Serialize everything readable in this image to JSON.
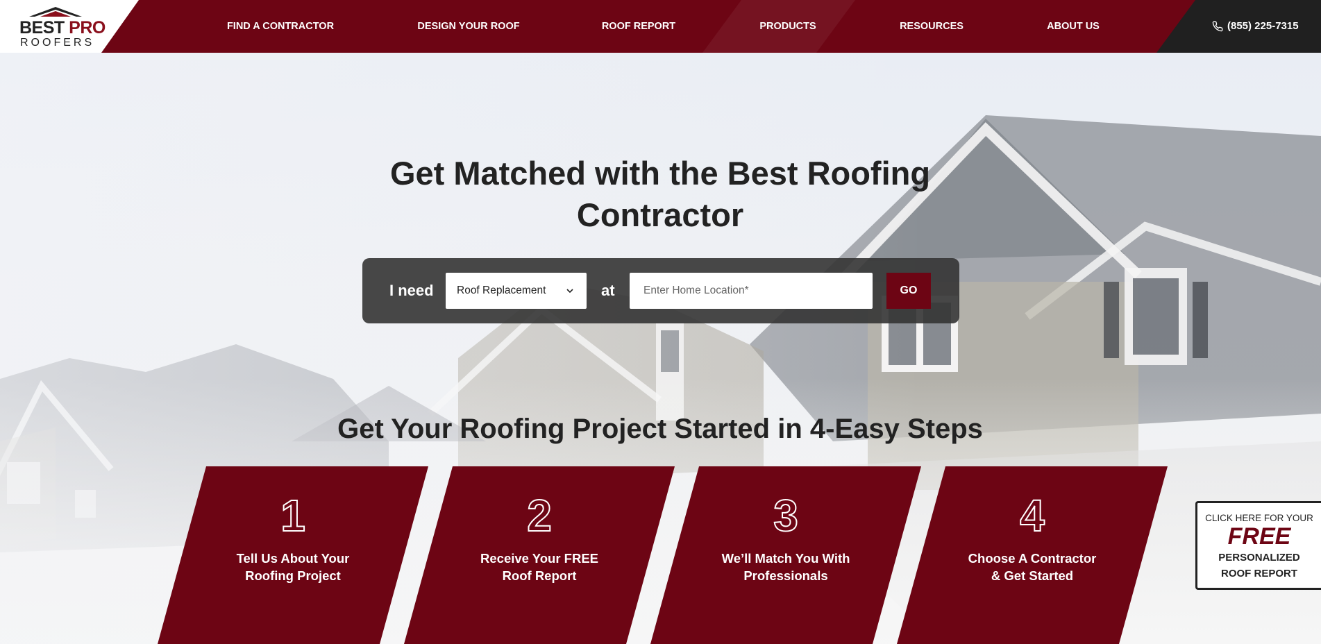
{
  "brand": {
    "name_part1": "BEST",
    "name_part2": "PRO",
    "name_line2": "ROOFERS",
    "primary_color": "#6d0514",
    "dark_color": "#202020"
  },
  "nav": {
    "items": [
      {
        "label": "FIND A CONTRACTOR"
      },
      {
        "label": "DESIGN YOUR ROOF"
      },
      {
        "label": "ROOF REPORT"
      },
      {
        "label": "PRODUCTS"
      },
      {
        "label": "RESOURCES"
      },
      {
        "label": "ABOUT US"
      }
    ],
    "phone": "(855) 225-7315"
  },
  "hero": {
    "title": "Get Matched with the Best Roofing Contractor",
    "search": {
      "i_need_label": "I need",
      "service_selected": "Roof Replacement",
      "at_label": "at",
      "location_placeholder": "Enter Home Location*",
      "go_label": "GO"
    }
  },
  "steps": {
    "title": "Get Your Roofing Project Started in 4-Easy Steps",
    "items": [
      {
        "number": "1",
        "line1": "Tell Us About Your",
        "line2": "Roofing Project"
      },
      {
        "number": "2",
        "line1": "Receive Your FREE",
        "line2": "Roof Report"
      },
      {
        "number": "3",
        "line1": "We’ll Match You With",
        "line2": "Professionals"
      },
      {
        "number": "4",
        "line1": "Choose A Contractor",
        "line2": "& Get Started"
      }
    ]
  },
  "report_card": {
    "line1": "CLICK HERE FOR YOUR",
    "free": "FREE",
    "line3": "PERSONALIZED",
    "line4": "ROOF REPORT"
  },
  "icons": {
    "phone": "phone-icon",
    "dropdown": "chevron-down-icon",
    "logo_roof": "roof-logo-icon"
  }
}
